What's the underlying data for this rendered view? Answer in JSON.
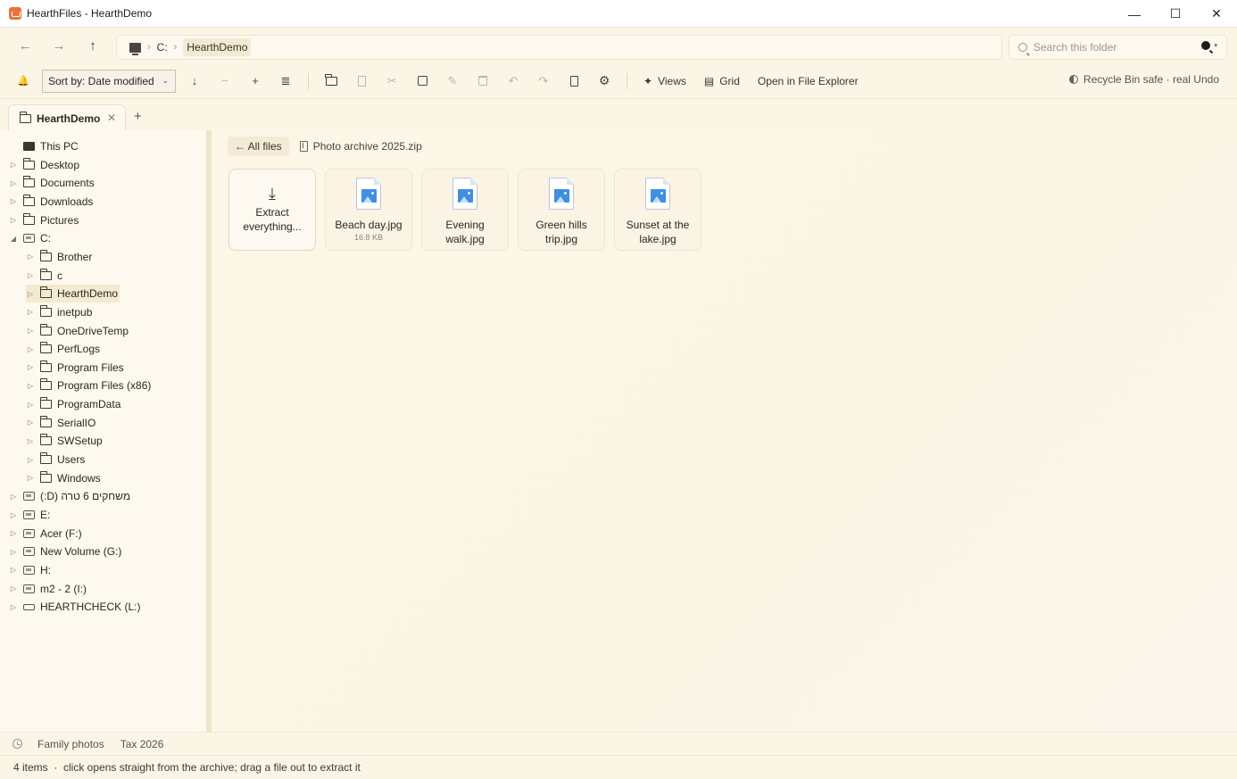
{
  "window": {
    "title": "HearthFiles - HearthDemo",
    "minimize_glyph": "—",
    "maximize_glyph": "☐",
    "close_glyph": "✕"
  },
  "nav": {
    "back_glyph": "←",
    "forward_glyph": "→",
    "up_glyph": "↑",
    "breadcrumb": [
      "C:",
      "HearthDemo"
    ],
    "separator": "›"
  },
  "search": {
    "placeholder": "Search this folder",
    "options_caret": "▾"
  },
  "toolbar": {
    "bell_glyph": "🔔",
    "sort_label": "Sort by: Date modified",
    "sort_caret": "⌄",
    "sort_direction_glyph": "↓",
    "zoom_out_glyph": "−",
    "zoom_in_glyph": "+",
    "details_glyph": "≣",
    "cut_glyph": "✂",
    "rename_glyph": "✎",
    "undo_glyph": "↶",
    "redo_glyph": "↷",
    "settings_glyph": "⚙",
    "views_label": "Views",
    "views_glyph": "✦",
    "grid_label": "Grid",
    "grid_glyph": "▤",
    "open_explorer_label": "Open in File Explorer",
    "recycle_note": "Recycle Bin safe · real Undo"
  },
  "tabs": {
    "items": [
      {
        "label": "HearthDemo"
      }
    ],
    "close_glyph": "✕",
    "add_glyph": "+"
  },
  "sidebar": {
    "items": [
      {
        "label": "This PC",
        "icon": "pc-icon",
        "level": 0,
        "expander": ""
      },
      {
        "label": "Desktop",
        "icon": "folder-icon",
        "level": 0,
        "expander": "▷"
      },
      {
        "label": "Documents",
        "icon": "folder-icon",
        "level": 0,
        "expander": "▷"
      },
      {
        "label": "Downloads",
        "icon": "folder-icon",
        "level": 0,
        "expander": "▷"
      },
      {
        "label": "Pictures",
        "icon": "folder-icon",
        "level": 0,
        "expander": "▷"
      },
      {
        "label": "C:",
        "icon": "drive-icon",
        "level": 0,
        "expander": "◢"
      },
      {
        "label": "Brother",
        "icon": "folder-icon",
        "level": 1,
        "expander": "▷"
      },
      {
        "label": "c",
        "icon": "folder-icon",
        "level": 1,
        "expander": "▷"
      },
      {
        "label": "HearthDemo",
        "icon": "folder-icon",
        "level": 1,
        "expander": "▷",
        "selected": true
      },
      {
        "label": "inetpub",
        "icon": "folder-icon",
        "level": 1,
        "expander": "▷"
      },
      {
        "label": "OneDriveTemp",
        "icon": "folder-icon",
        "level": 1,
        "expander": "▷"
      },
      {
        "label": "PerfLogs",
        "icon": "folder-icon",
        "level": 1,
        "expander": "▷"
      },
      {
        "label": "Program Files",
        "icon": "folder-icon",
        "level": 1,
        "expander": "▷"
      },
      {
        "label": "Program Files (x86)",
        "icon": "folder-icon",
        "level": 1,
        "expander": "▷"
      },
      {
        "label": "ProgramData",
        "icon": "folder-icon",
        "level": 1,
        "expander": "▷"
      },
      {
        "label": "SerialIO",
        "icon": "folder-icon",
        "level": 1,
        "expander": "▷"
      },
      {
        "label": "SWSetup",
        "icon": "folder-icon",
        "level": 1,
        "expander": "▷"
      },
      {
        "label": "Users",
        "icon": "folder-icon",
        "level": 1,
        "expander": "▷"
      },
      {
        "label": "Windows",
        "icon": "folder-icon",
        "level": 1,
        "expander": "▷"
      },
      {
        "label": "(:D) משחקים 6 טרה",
        "icon": "drive-icon",
        "level": 0,
        "expander": "▷"
      },
      {
        "label": "E:",
        "icon": "drive-icon",
        "level": 0,
        "expander": "▷"
      },
      {
        "label": "Acer (F:)",
        "icon": "drive-icon",
        "level": 0,
        "expander": "▷"
      },
      {
        "label": "New Volume (G:)",
        "icon": "drive-icon",
        "level": 0,
        "expander": "▷"
      },
      {
        "label": "H:",
        "icon": "drive-icon",
        "level": 0,
        "expander": "▷"
      },
      {
        "label": "m2 - 2 (I:)",
        "icon": "drive-icon",
        "level": 0,
        "expander": "▷"
      },
      {
        "label": "HEARTHCHECK (L:)",
        "icon": "usb-drive-icon",
        "level": 0,
        "expander": "▷"
      }
    ]
  },
  "content": {
    "back_label": "← All files",
    "archive_name": "Photo archive 2025.zip",
    "extract_arrow_glyph": "⤓",
    "tiles": [
      {
        "label": "Extract everything...",
        "size": "",
        "kind": "extract"
      },
      {
        "label": "Beach day.jpg",
        "size": "16.8 KB",
        "kind": "image"
      },
      {
        "label": "Evening walk.jpg",
        "size": "",
        "kind": "image"
      },
      {
        "label": "Green hills trip.jpg",
        "size": "",
        "kind": "image"
      },
      {
        "label": "Sunset at the lake.jpg",
        "size": "",
        "kind": "image"
      }
    ]
  },
  "quick_access": [
    "Family photos",
    "Tax 2026"
  ],
  "status": {
    "text": "4 items  ·  click opens straight from the archive; drag a file out to extract it"
  },
  "colors": {
    "background": "#fbf5e6",
    "selection": "#f4ead0",
    "accent": "#e8743b",
    "image_blue": "#3f8fe3"
  }
}
